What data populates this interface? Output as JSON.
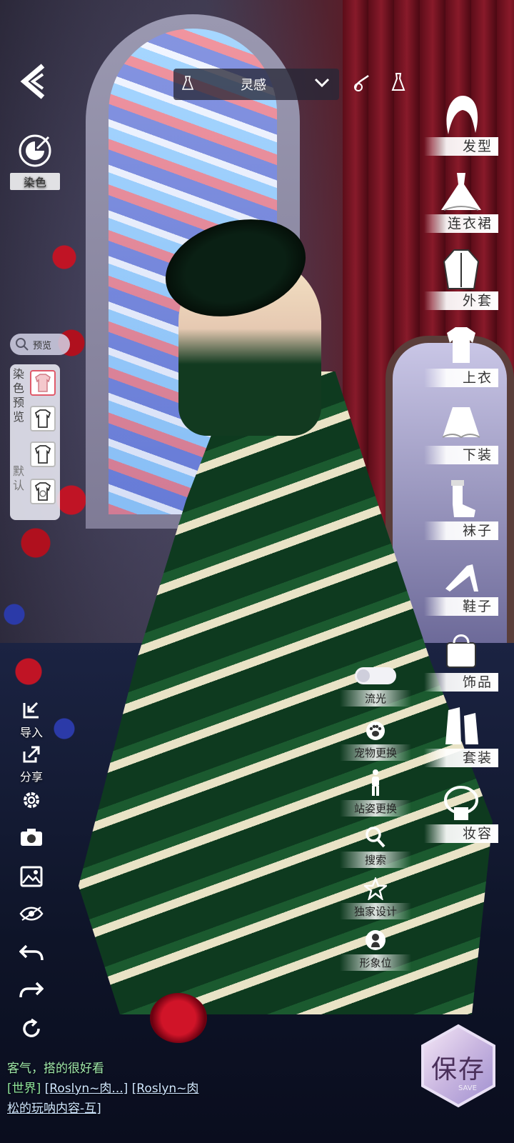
{
  "top_bar": {
    "title": "灵感"
  },
  "left_panel": {
    "dye_label": "染色",
    "preview_label": "预览",
    "dye_preview_vertical": [
      "染",
      "色",
      "预",
      "览"
    ],
    "default_vertical": [
      "默",
      "认"
    ]
  },
  "categories": [
    {
      "label": "发型",
      "icon": "hair-icon"
    },
    {
      "label": "连衣裙",
      "icon": "dress-icon"
    },
    {
      "label": "外套",
      "icon": "coat-icon"
    },
    {
      "label": "上衣",
      "icon": "top-icon"
    },
    {
      "label": "下装",
      "icon": "skirt-icon"
    },
    {
      "label": "袜子",
      "icon": "socks-icon"
    },
    {
      "label": "鞋子",
      "icon": "shoes-icon"
    },
    {
      "label": "饰品",
      "icon": "accessory-icon"
    },
    {
      "label": "套装",
      "icon": "suit-icon"
    },
    {
      "label": "妆容",
      "icon": "makeup-icon"
    }
  ],
  "left_tools": {
    "import_label": "导入",
    "share_label": "分享"
  },
  "mid_tools": {
    "glow_label": "流光",
    "pet_label": "宠物更换",
    "pose_label": "站姿更换",
    "search_label": "搜索",
    "exclusive_label": "独家设计",
    "image_label": "形象位"
  },
  "chat": {
    "line1": "客气，搭的很好看",
    "world_tag": "[世界]",
    "user1": "[Roslyn~肉...]",
    "user2": "[Roslyn~肉",
    "line3": "松的玩呐内容-互]"
  },
  "save": {
    "label": "保存",
    "sub": "SAVE"
  }
}
